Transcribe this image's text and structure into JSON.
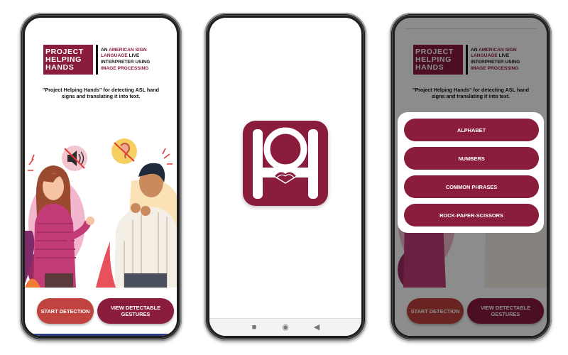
{
  "app": {
    "logo_line1": "PROJECT",
    "logo_line2": "HELPING",
    "logo_line3": "HANDS",
    "tag_an": "AN",
    "tag_american_sign": "AMERICAN SIGN",
    "tag_language": "LANGUAGE",
    "tag_live": "LIVE",
    "tag_interpreter": "INTERPRETER USING",
    "tag_image": "IMAGE PROCESSING",
    "description": "\"Project Helping Hands\" for detecting ASL hand signs and translating it into text."
  },
  "home": {
    "start_label": "START DETECTION",
    "view_label": "VIEW DETECTABLE GESTURES"
  },
  "menu": {
    "items": [
      {
        "label": "ALPHABET"
      },
      {
        "label": "NUMBERS"
      },
      {
        "label": "COMMON PHRASES"
      },
      {
        "label": "ROCK-PAPER-SCISSORS"
      }
    ]
  },
  "navbar": {
    "icons": [
      "square-recent-icon",
      "circle-home-icon",
      "triangle-back-icon"
    ]
  },
  "colors": {
    "brand": "#8a1c3c",
    "start": "#c0433f"
  }
}
